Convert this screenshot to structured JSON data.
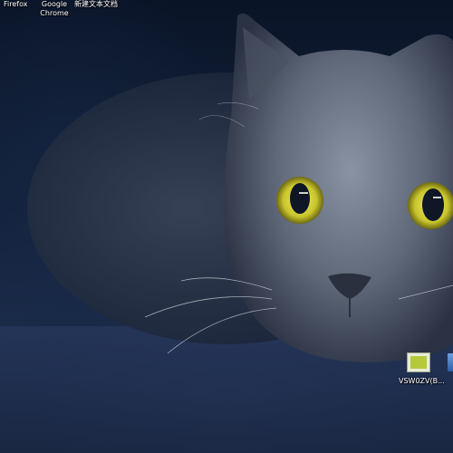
{
  "desktop": {
    "icons": [
      {
        "label": "Firefox"
      },
      {
        "label_line1": "Google",
        "label_line2": "Chrome"
      },
      {
        "label": "新建文本文档"
      }
    ],
    "file": {
      "label": "VSW0ZV(B..."
    }
  },
  "wallpaper": {
    "subject": "grey cat with yellow eyes",
    "colors": {
      "fur": "#6b7484",
      "eyes": "#d8d23a",
      "background": "#13223b"
    }
  }
}
